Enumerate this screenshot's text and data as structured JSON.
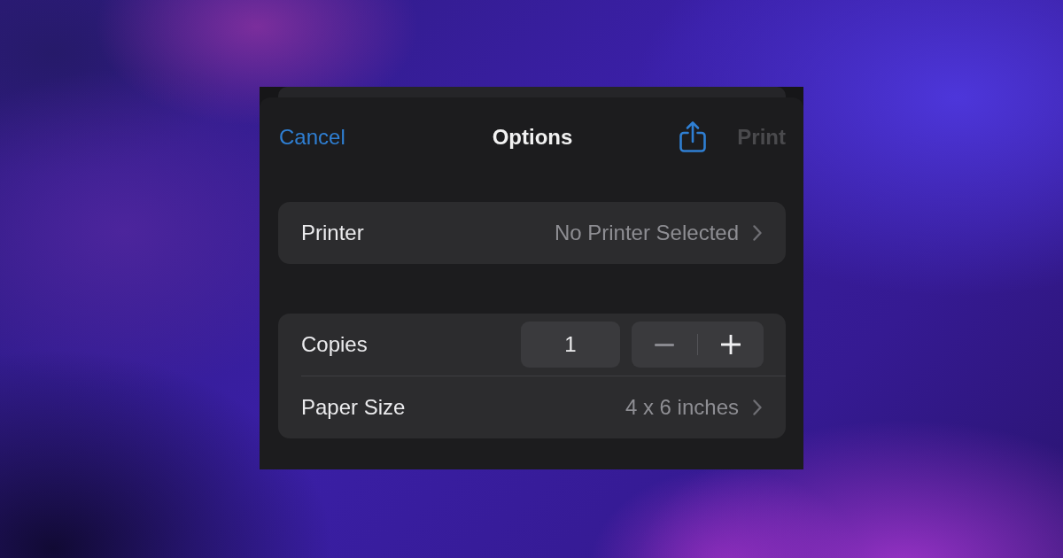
{
  "header": {
    "cancel": "Cancel",
    "title": "Options",
    "print": {
      "label": "Print",
      "disabled": true
    }
  },
  "sections": [
    {
      "rows": [
        {
          "kind": "disclosure",
          "label": "Printer",
          "value": "No Printer Selected"
        }
      ]
    },
    {
      "rows": [
        {
          "kind": "stepper",
          "label": "Copies",
          "value": "1",
          "decrement_disabled": true
        },
        {
          "kind": "disclosure",
          "label": "Paper Size",
          "value": "4 x 6 inches"
        }
      ]
    }
  ]
}
